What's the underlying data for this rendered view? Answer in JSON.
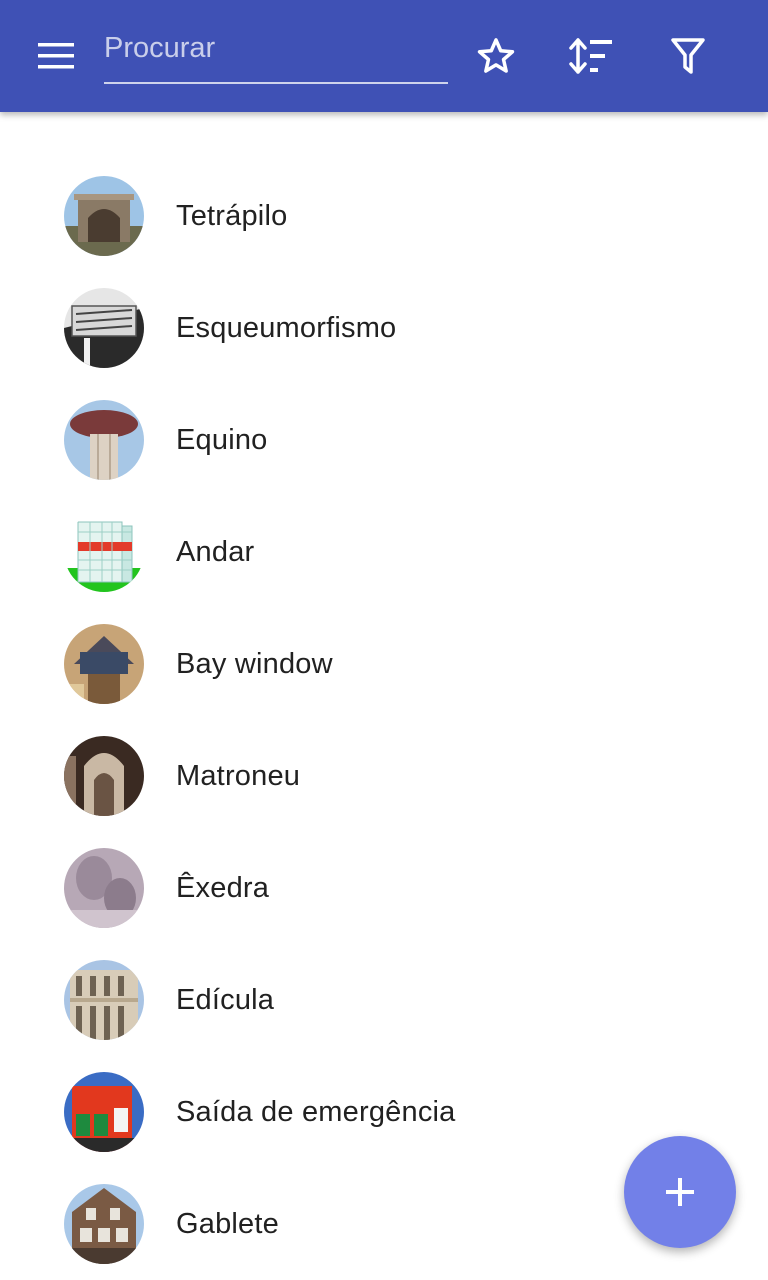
{
  "app_bar": {
    "menu_icon": "menu-icon",
    "search": {
      "value": "",
      "placeholder": "Procurar"
    },
    "actions": [
      {
        "name": "favorites",
        "icon": "star-outline-icon"
      },
      {
        "name": "sort",
        "icon": "sort-icon"
      },
      {
        "name": "filter",
        "icon": "filter-icon"
      }
    ],
    "background_color": "#3f51b5"
  },
  "list": {
    "items": [
      {
        "label": "Tetrápilo"
      },
      {
        "label": "Esqueumorfismo"
      },
      {
        "label": "Equino"
      },
      {
        "label": "Andar"
      },
      {
        "label": "Bay window"
      },
      {
        "label": "Matroneu"
      },
      {
        "label": "Êxedra"
      },
      {
        "label": "Edícula"
      },
      {
        "label": "Saída de emergência"
      },
      {
        "label": "Gablete"
      }
    ]
  },
  "fab": {
    "icon": "plus-icon",
    "color": "#7280e8"
  }
}
